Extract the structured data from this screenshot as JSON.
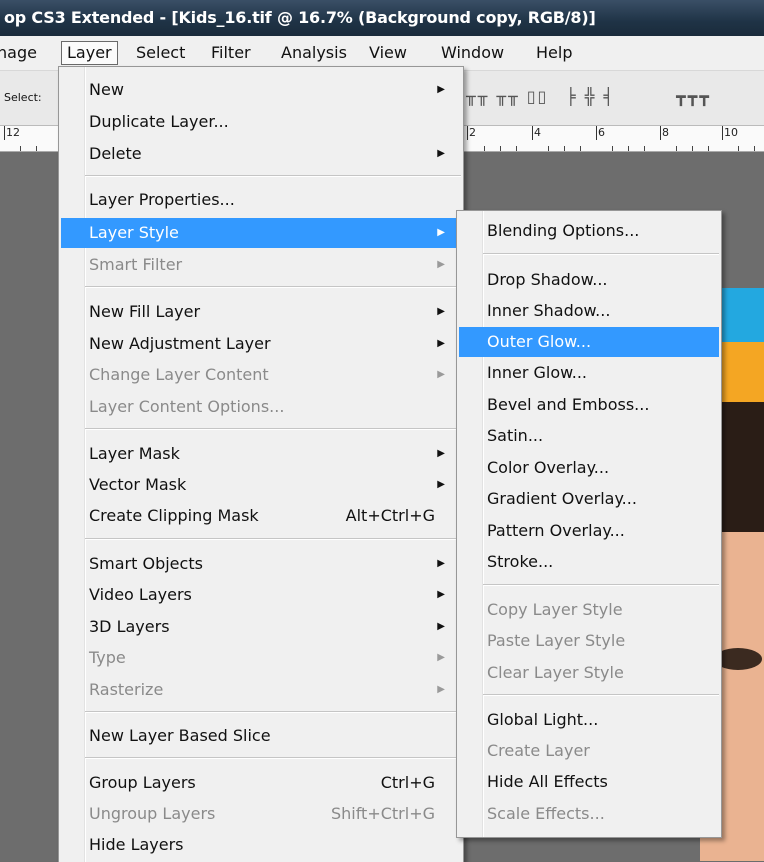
{
  "titlebar": {
    "title": "op CS3 Extended - [Kids_16.tif @ 16.7% (Background copy, RGB/8)]"
  },
  "menubar": {
    "items": [
      "nage",
      "Layer",
      "Select",
      "Filter",
      "Analysis",
      "View",
      "Window",
      "Help"
    ]
  },
  "options": {
    "select_label": "Select:"
  },
  "ruler": {
    "labels": [
      "12",
      "2",
      "4",
      "6",
      "8",
      "10"
    ]
  },
  "layer_menu": {
    "items": [
      {
        "label": "New",
        "submenu": true
      },
      {
        "label": "Duplicate Layer..."
      },
      {
        "label": "Delete",
        "submenu": true
      },
      {
        "label": "Layer Properties..."
      },
      {
        "label": "Layer Style",
        "submenu": true,
        "highlight": true
      },
      {
        "label": "Smart Filter",
        "submenu": true,
        "disabled": true
      },
      {
        "label": "New Fill Layer",
        "submenu": true
      },
      {
        "label": "New Adjustment Layer",
        "submenu": true
      },
      {
        "label": "Change Layer Content",
        "submenu": true,
        "disabled": true
      },
      {
        "label": "Layer Content Options...",
        "disabled": true
      },
      {
        "label": "Layer Mask",
        "submenu": true
      },
      {
        "label": "Vector Mask",
        "submenu": true
      },
      {
        "label": "Create Clipping Mask",
        "shortcut": "Alt+Ctrl+G"
      },
      {
        "label": "Smart Objects",
        "submenu": true
      },
      {
        "label": "Video Layers",
        "submenu": true
      },
      {
        "label": "3D Layers",
        "submenu": true
      },
      {
        "label": "Type",
        "submenu": true,
        "disabled": true
      },
      {
        "label": "Rasterize",
        "submenu": true,
        "disabled": true
      },
      {
        "label": "New Layer Based Slice"
      },
      {
        "label": "Group Layers",
        "shortcut": "Ctrl+G"
      },
      {
        "label": "Ungroup Layers",
        "shortcut": "Shift+Ctrl+G",
        "disabled": true
      },
      {
        "label": "Hide Layers"
      }
    ]
  },
  "style_menu": {
    "items": [
      {
        "label": "Blending Options..."
      },
      {
        "label": "Drop Shadow..."
      },
      {
        "label": "Inner Shadow..."
      },
      {
        "label": "Outer Glow...",
        "highlight": true
      },
      {
        "label": "Inner Glow..."
      },
      {
        "label": "Bevel and Emboss..."
      },
      {
        "label": "Satin..."
      },
      {
        "label": "Color Overlay..."
      },
      {
        "label": "Gradient Overlay..."
      },
      {
        "label": "Pattern Overlay..."
      },
      {
        "label": "Stroke..."
      },
      {
        "label": "Copy Layer Style",
        "disabled": true
      },
      {
        "label": "Paste Layer Style",
        "disabled": true
      },
      {
        "label": "Clear Layer Style",
        "disabled": true
      },
      {
        "label": "Global Light..."
      },
      {
        "label": "Create Layer",
        "disabled": true
      },
      {
        "label": "Hide All Effects"
      },
      {
        "label": "Scale Effects...",
        "disabled": true
      }
    ]
  },
  "icons": {
    "submenu_arrow": "right-triangle-icon"
  },
  "colors": {
    "highlight": "#3399ff",
    "menu_bg": "#f0f0f0",
    "disabled_text": "#8a8a8a"
  }
}
